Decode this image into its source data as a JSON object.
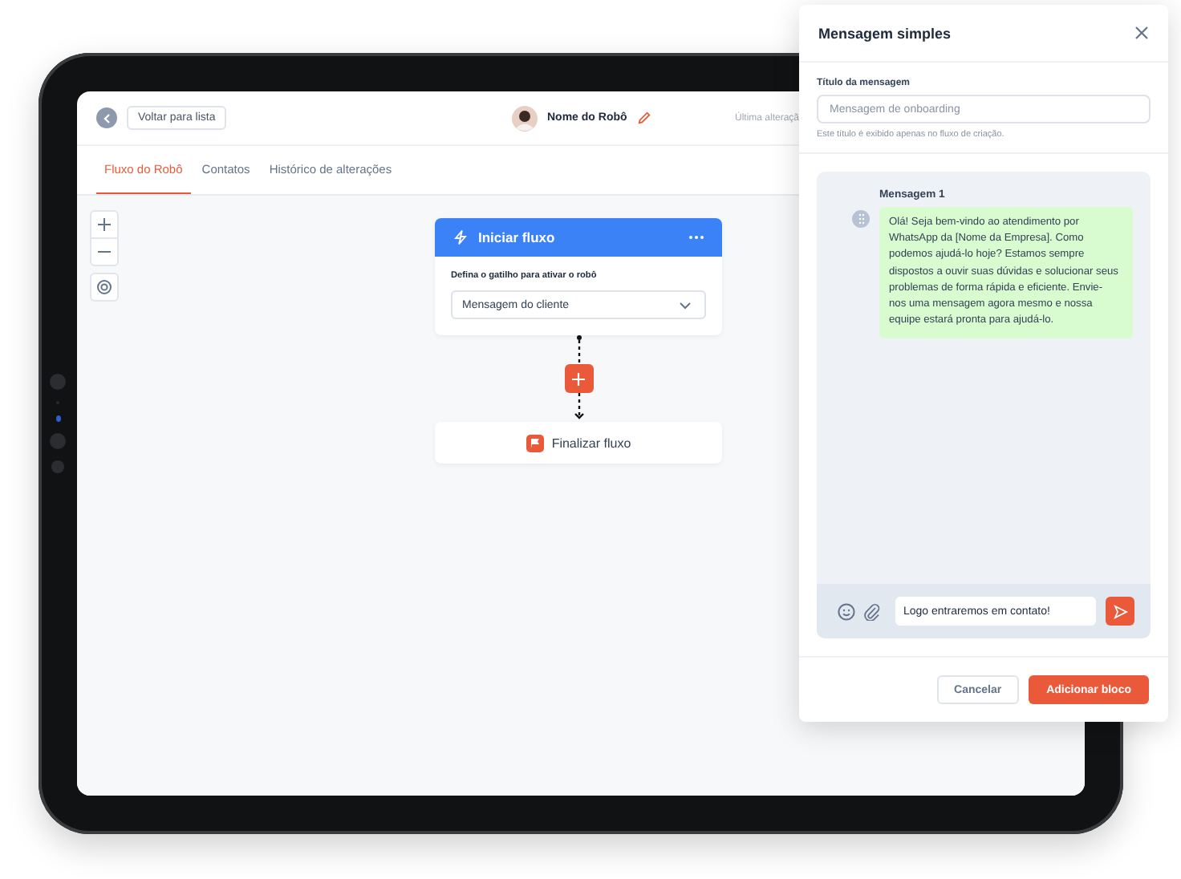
{
  "header": {
    "back_button": "Voltar para lista",
    "robot_name": "Nome do Robô",
    "last_change": "Última alteraçã"
  },
  "tabs": [
    {
      "label": "Fluxo do Robô",
      "selected": true
    },
    {
      "label": "Contatos",
      "selected": false
    },
    {
      "label": "Histórico de alterações",
      "selected": false
    }
  ],
  "flow": {
    "start_node": {
      "title": "Iniciar fluxo",
      "trigger_label": "Defina o gatilho para ativar o robô",
      "trigger_value": "Mensagem do cliente"
    },
    "end_node": {
      "title": "Finalizar fluxo"
    }
  },
  "panel": {
    "title": "Mensagem simples",
    "title_field": {
      "label": "Título da mensagem",
      "placeholder": "Mensagem de onboarding",
      "hint": "Este título é exibido apenas no fluxo de criação."
    },
    "messages": [
      {
        "label": "Mensagem 1",
        "text": "Olá! Seja bem-vindo ao atendimento por WhatsApp da [Nome da Empresa]. Como podemos ajudá-lo hoje? Estamos sempre dispostos a ouvir suas dúvidas e solucionar seus problemas de forma rápida e eficiente. Envie-nos uma mensagem agora mesmo e nossa equipe estará pronta para ajudá-lo."
      }
    ],
    "composer": {
      "value": "Logo entraremos em contato!"
    },
    "buttons": [
      {
        "label": "Cancelar",
        "kind": "secondary"
      },
      {
        "label": "Adicionar bloco",
        "kind": "primary"
      }
    ]
  }
}
